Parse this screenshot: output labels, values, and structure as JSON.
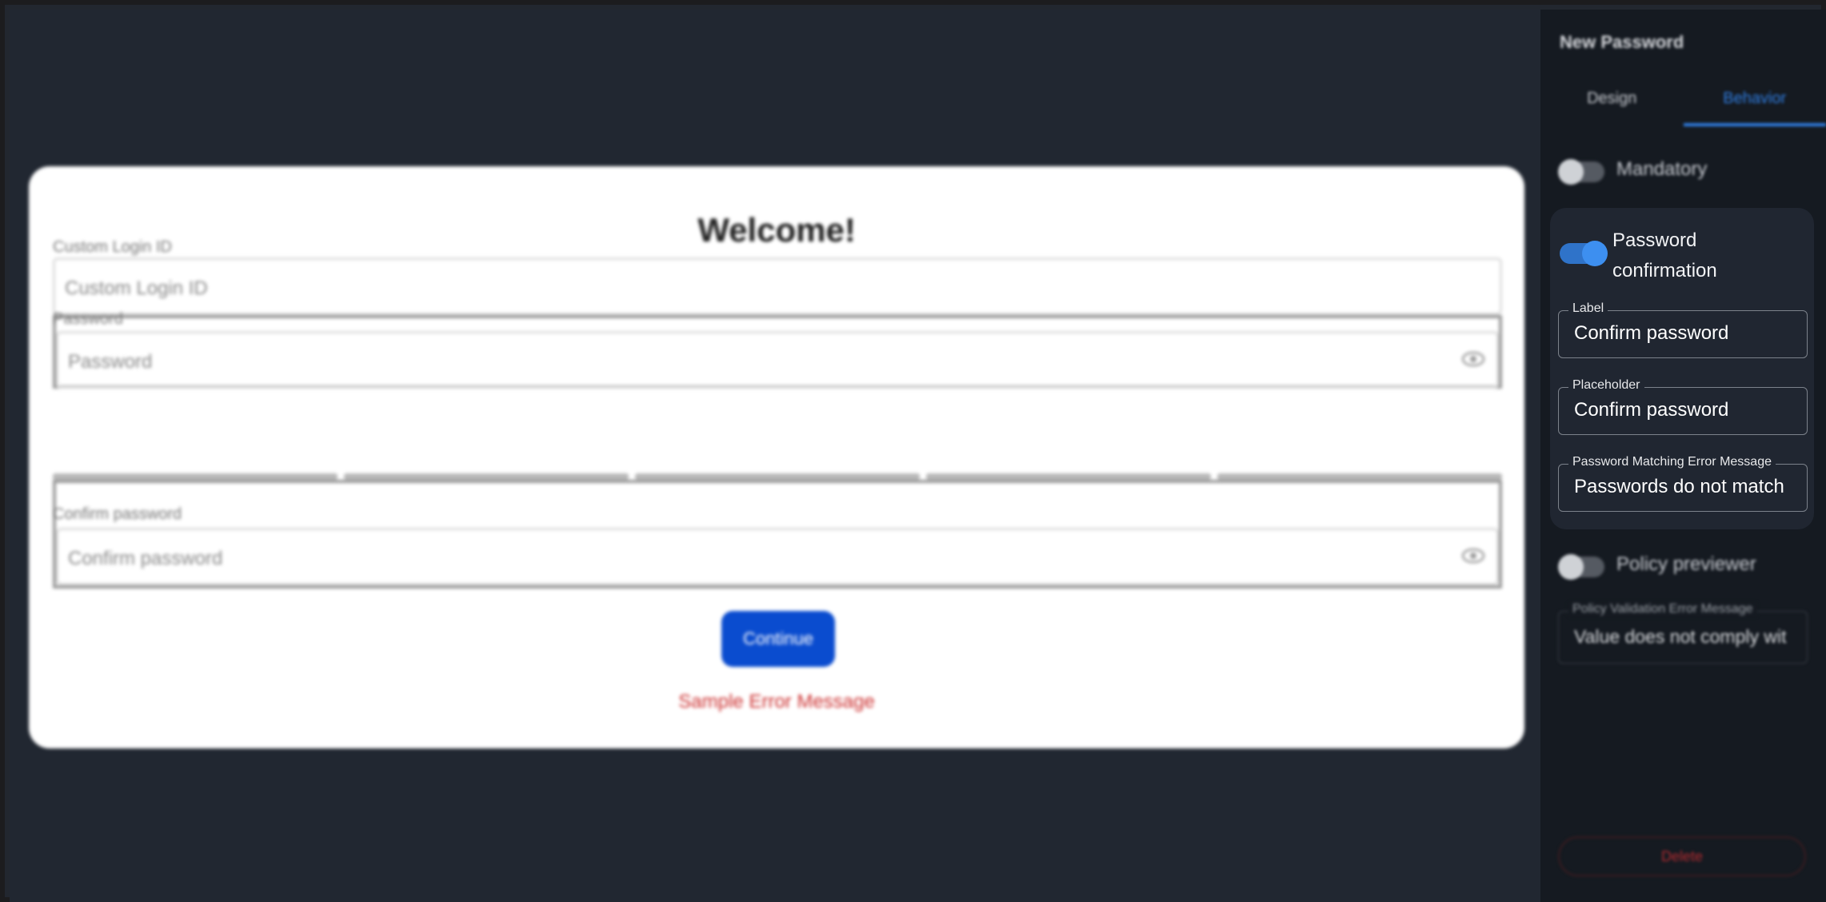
{
  "preview": {
    "title": "Welcome!",
    "login_id": {
      "label": "Custom Login ID",
      "placeholder": "Custom Login ID"
    },
    "password": {
      "label": "Password",
      "placeholder": "Password"
    },
    "confirm": {
      "label": "Confirm password",
      "placeholder": "Confirm password"
    },
    "continue_label": "Continue",
    "error_message": "Sample Error Message"
  },
  "panel": {
    "title": "New Password",
    "tabs": [
      {
        "label": "Design",
        "active": false
      },
      {
        "label": "Behavior",
        "active": true
      }
    ],
    "mandatory": {
      "label": "Mandatory",
      "on": false
    },
    "password_confirmation": {
      "label": "Password confirmation",
      "on": true,
      "fields": {
        "label": {
          "legend": "Label",
          "value": "Confirm password"
        },
        "placeholder": {
          "legend": "Placeholder",
          "value": "Confirm password"
        },
        "matching_error": {
          "legend": "Password Matching Error Message",
          "value": "Passwords do not match"
        }
      }
    },
    "policy_previewer": {
      "label": "Policy previewer",
      "on": false
    },
    "policy_error": {
      "legend": "Policy Validation Error Message",
      "value": "Value does not comply wit"
    },
    "delete_label": "Delete"
  },
  "colors": {
    "accent": "#2f7de1",
    "continue": "#0a4ccf",
    "error": "#cc3030"
  }
}
